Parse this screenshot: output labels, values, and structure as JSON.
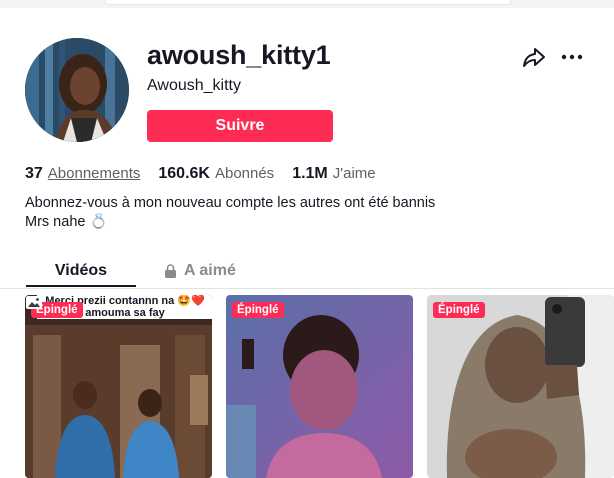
{
  "profile": {
    "username": "awoush_kitty1",
    "nickname": "Awoush_kitty",
    "follow_label": "Suivre",
    "bio_lines": [
      "Abonnez-vous à mon nouveau compte les autres ont été bannis",
      "Mrs nahe 💍"
    ]
  },
  "stats": {
    "following_count": "37",
    "following_label": "Abonnements",
    "followers_count": "160.6K",
    "followers_label": "Abonnés",
    "likes_count": "1.1M",
    "likes_label": "J'aime"
  },
  "tabs": {
    "videos": "Vidéos",
    "liked": "A aimé"
  },
  "videos": [
    {
      "pinned_label": "Épinglé",
      "caption_lines": [
        "Merci prezii contannn na 🤩❤️",
        "amouma sa fay"
      ]
    },
    {
      "pinned_label": "Épinglé"
    },
    {
      "pinned_label": "Épinglé"
    }
  ],
  "icons": {
    "share": "share-icon",
    "more": "more-icon",
    "lock": "lock-icon",
    "photo": "photo-icon"
  },
  "colors": {
    "accent": "#fe2c55",
    "text": "#161823",
    "secondary": "#5e5f66"
  }
}
